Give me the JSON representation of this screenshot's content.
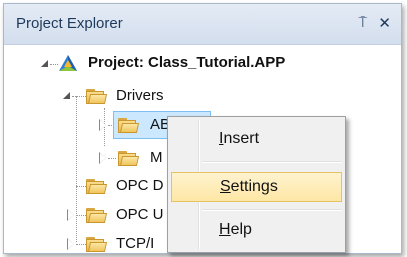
{
  "panel": {
    "title": "Project Explorer",
    "pin_glyph": "⍑",
    "close_glyph": "✕"
  },
  "tree": {
    "project": {
      "label": "Project: Class_Tutorial.APP",
      "icon": "project-icon"
    },
    "drivers": {
      "label": "Drivers",
      "icon": "folder-icon"
    },
    "abcip": {
      "label": "ABCIP",
      "icon": "folder-icon"
    },
    "m_item": {
      "label": "M",
      "icon": "folder-icon"
    },
    "opc_d": {
      "label": "OPC D",
      "icon": "folder-icon"
    },
    "opc_u": {
      "label": "OPC U",
      "icon": "folder-icon"
    },
    "tcp": {
      "label": "TCP/I",
      "icon": "folder-icon"
    }
  },
  "context_menu": {
    "items": [
      {
        "label": "Insert",
        "accelerator": "I",
        "rest": "nsert",
        "highlighted": false
      },
      {
        "label": "Settings",
        "accelerator": "S",
        "rest": "ettings",
        "highlighted": true
      },
      {
        "label": "Help",
        "accelerator": "H",
        "rest": "elp",
        "highlighted": false
      }
    ]
  },
  "colors": {
    "titlebar": "#d3deee",
    "title_text": "#1e395b",
    "selection": "#cce8ff",
    "menu_highlight": "#fde7a5",
    "folder": "#f0c55e"
  }
}
